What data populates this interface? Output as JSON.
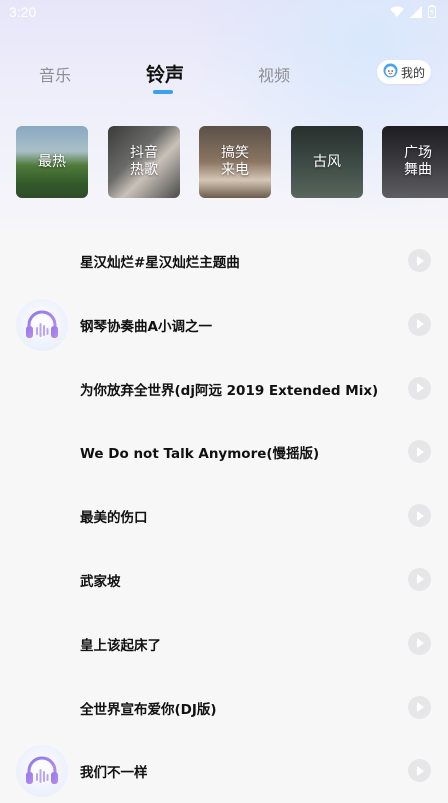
{
  "status_bar": {
    "time": "3:20",
    "icons": [
      "wifi-icon",
      "signal-icon",
      "battery-icon"
    ]
  },
  "tabs": [
    {
      "label": "音乐",
      "active": false
    },
    {
      "label": "铃声",
      "active": true
    },
    {
      "label": "视频",
      "active": false
    }
  ],
  "mine_button": {
    "label": "我的",
    "icon": "avatar-icon"
  },
  "categories": [
    {
      "label": "最热"
    },
    {
      "label": "抖音\n热歌"
    },
    {
      "label": "搞笑\n来电"
    },
    {
      "label": "古风"
    },
    {
      "label": "广场\n舞曲"
    }
  ],
  "ringtones": [
    {
      "title": "星汉灿烂#星汉灿烂主题曲",
      "has_cover": false
    },
    {
      "title": "钢琴协奏曲A小调之一",
      "has_cover": true
    },
    {
      "title": "为你放弃全世界(dj阿远 2019 Extended Mix)",
      "has_cover": false
    },
    {
      "title": "We Do not Talk Anymore(慢摇版)",
      "has_cover": false
    },
    {
      "title": "最美的伤口",
      "has_cover": false
    },
    {
      "title": "武家坡",
      "has_cover": false
    },
    {
      "title": "皇上该起床了",
      "has_cover": false
    },
    {
      "title": "全世界宣布爱你(DJ版)",
      "has_cover": false
    },
    {
      "title": "我们不一样",
      "has_cover": true
    }
  ],
  "colors": {
    "accent": "#3aa0f0",
    "play_button": "#e6e6e9"
  }
}
